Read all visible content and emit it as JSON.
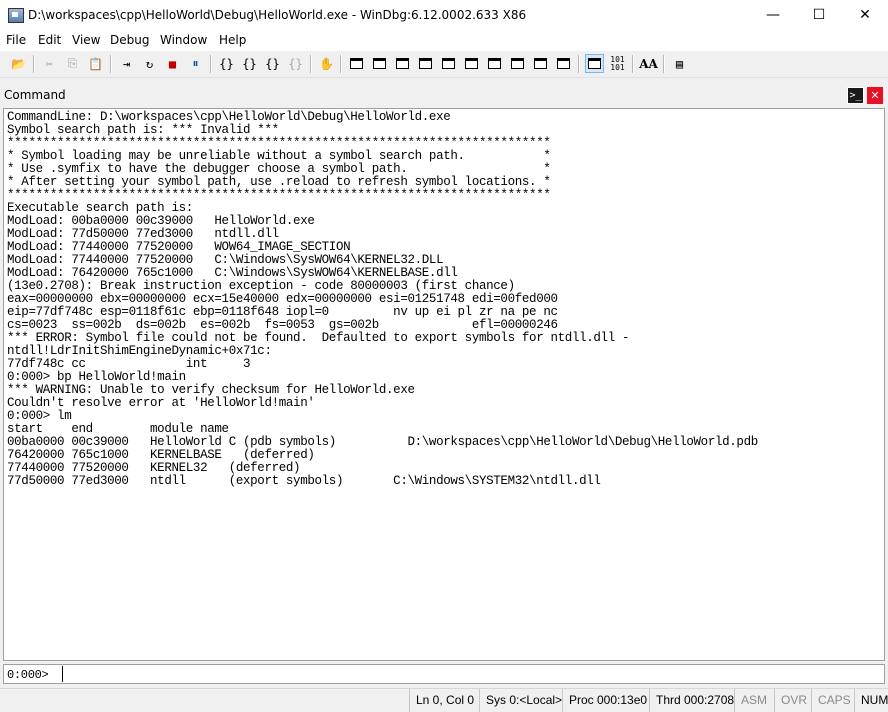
{
  "window": {
    "title": "D:\\workspaces\\cpp\\HelloWorld\\Debug\\HelloWorld.exe - WinDbg:6.12.0002.633 X86",
    "minimize": "—",
    "maximize": "☐",
    "close": "✕"
  },
  "menu": [
    "File",
    "Edit",
    "View",
    "Debug",
    "Window",
    "Help"
  ],
  "toolbar": {
    "open": "📂",
    "cut": "✂",
    "copy": "⎘",
    "paste": "📋",
    "step_into": "{}",
    "step_over": "{}",
    "step_out": "{}",
    "run_to_cursor": "{}",
    "go": "⇥",
    "restart": "↻",
    "stop": "■",
    "break": "✋",
    "font": "AA",
    "options": "▤"
  },
  "command_window": {
    "title": "Command",
    "prompt_icon": ">_",
    "close_icon": "✕",
    "output_lines": [
      "CommandLine: D:\\workspaces\\cpp\\HelloWorld\\Debug\\HelloWorld.exe",
      "Symbol search path is: *** Invalid ***",
      "****************************************************************************",
      "* Symbol loading may be unreliable without a symbol search path.           *",
      "* Use .symfix to have the debugger choose a symbol path.                   *",
      "* After setting your symbol path, use .reload to refresh symbol locations. *",
      "****************************************************************************",
      "Executable search path is:",
      "ModLoad: 00ba0000 00c39000   HelloWorld.exe",
      "ModLoad: 77d50000 77ed3000   ntdll.dll",
      "ModLoad: 77440000 77520000   WOW64_IMAGE_SECTION",
      "ModLoad: 77440000 77520000   C:\\Windows\\SysWOW64\\KERNEL32.DLL",
      "ModLoad: 76420000 765c1000   C:\\Windows\\SysWOW64\\KERNELBASE.dll",
      "(13e0.2708): Break instruction exception - code 80000003 (first chance)",
      "eax=00000000 ebx=00000000 ecx=15e40000 edx=00000000 esi=01251748 edi=00fed000",
      "eip=77df748c esp=0118f61c ebp=0118f648 iopl=0         nv up ei pl zr na pe nc",
      "cs=0023  ss=002b  ds=002b  es=002b  fs=0053  gs=002b             efl=00000246",
      "*** ERROR: Symbol file could not be found.  Defaulted to export symbols for ntdll.dll -",
      "ntdll!LdrInitShimEngineDynamic+0x71c:",
      "77df748c cc              int     3",
      "0:000> bp HelloWorld!main",
      "*** WARNING: Unable to verify checksum for HelloWorld.exe",
      "Couldn't resolve error at 'HelloWorld!main'",
      "0:000> lm",
      "start    end        module name",
      "00ba0000 00c39000   HelloWorld C (pdb symbols)          D:\\workspaces\\cpp\\HelloWorld\\Debug\\HelloWorld.pdb",
      "76420000 765c1000   KERNELBASE   (deferred)",
      "77440000 77520000   KERNEL32   (deferred)",
      "77d50000 77ed3000   ntdll      (export symbols)       C:\\Windows\\SYSTEM32\\ntdll.dll"
    ],
    "prompt": "0:000>",
    "input_value": ""
  },
  "status": {
    "lncol": "Ln 0, Col 0",
    "sys": "Sys 0:<Local>",
    "proc": "Proc 000:13e0",
    "thrd": "Thrd 000:2708",
    "asm": "ASM",
    "ovr": "OVR",
    "caps": "CAPS",
    "num": "NUM"
  }
}
